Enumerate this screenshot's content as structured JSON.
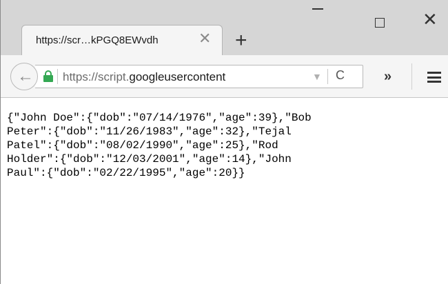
{
  "tab": {
    "title": "https://scr…kPGQ8EWvdh",
    "close_glyph": "✕",
    "new_tab_glyph": "+"
  },
  "window_controls": {
    "close_glyph": "✕"
  },
  "toolbar": {
    "back_glyph": "←",
    "url_prefix": "https://script.",
    "url_domain": "googleusercontent",
    "dropdown_glyph": "▼",
    "reload_glyph": "C",
    "overflow_glyph": "»"
  },
  "page": {
    "lines": [
      "{\"John Doe\":{\"dob\":\"07/14/1976\",\"age\":39},\"Bob",
      "Peter\":{\"dob\":\"11/26/1983\",\"age\":32},\"Tejal",
      "Patel\":{\"dob\":\"08/02/1990\",\"age\":25},\"Rod",
      "Holder\":{\"dob\":\"12/03/2001\",\"age\":14},\"John",
      "Paul\":{\"dob\":\"02/22/1995\",\"age\":20}}"
    ]
  },
  "icons": [
    "close-icon",
    "plus-icon",
    "minimize-icon",
    "maximize-icon",
    "back-arrow-icon",
    "lock-icon",
    "dropdown-icon",
    "reload-icon",
    "overflow-icon",
    "hamburger-menu-icon"
  ],
  "colors": {
    "lock_green": "#34a853",
    "tab_strip": "#d6d6d6",
    "toolbar": "#f5f5f5"
  }
}
